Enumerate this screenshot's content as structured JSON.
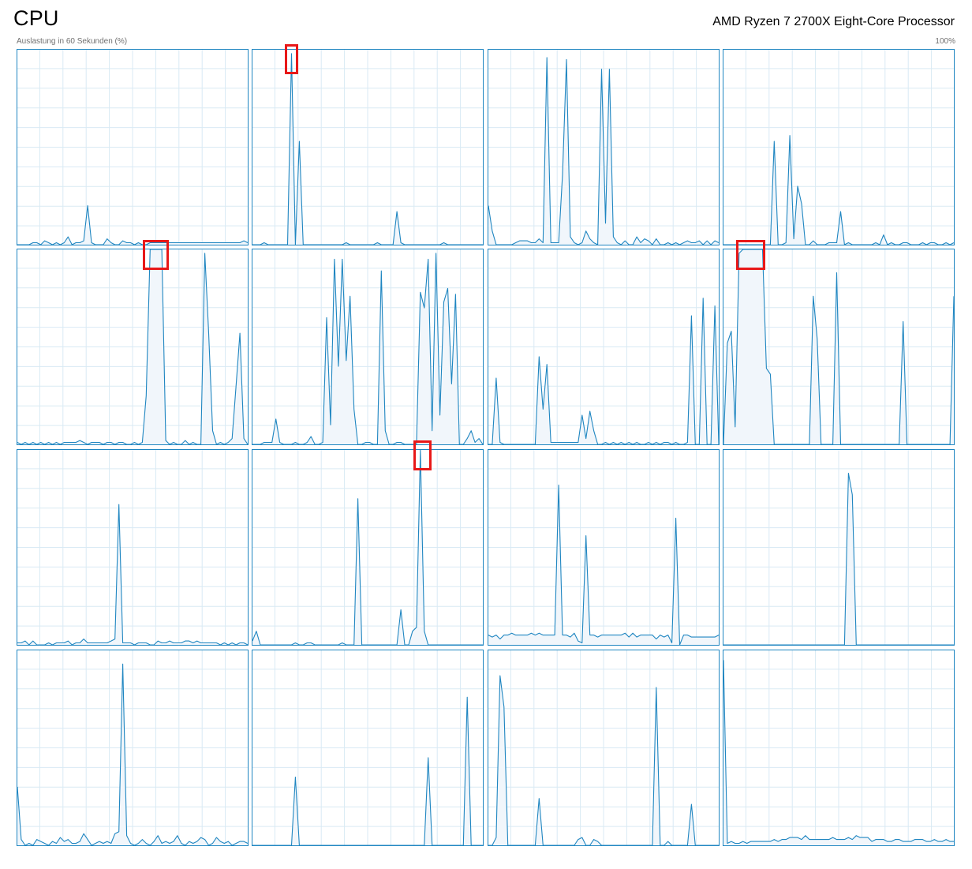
{
  "header": {
    "title": "CPU",
    "processor": "AMD Ryzen 7 2700X Eight-Core Processor",
    "utilization_label": "Auslastung in 60 Sekunden (%)",
    "max_label": "100%"
  },
  "colors": {
    "line": "#1f86c1",
    "fill": "#f1f6fb",
    "grid": "#d9eaf4",
    "border": "#1f86c1",
    "highlight": "#e81818"
  },
  "chart_data": {
    "type": "area",
    "ylim": [
      0,
      100
    ],
    "samples": 60,
    "grid": true,
    "series": [
      {
        "values": [
          0,
          0,
          0,
          0,
          1,
          1,
          0,
          2,
          1,
          0,
          1,
          0,
          1,
          4,
          0,
          1,
          1,
          2,
          20,
          1,
          0,
          0,
          0,
          3,
          1,
          0,
          0,
          2,
          1,
          1,
          0,
          1,
          0,
          0,
          1,
          1,
          1,
          1,
          1,
          1,
          1,
          1,
          1,
          1,
          1,
          1,
          1,
          1,
          1,
          1,
          1,
          1,
          1,
          1,
          1,
          1,
          1,
          1,
          2,
          1
        ]
      },
      {
        "values": [
          0,
          0,
          0,
          1,
          0,
          0,
          0,
          0,
          0,
          0,
          98,
          0,
          53,
          0,
          0,
          0,
          0,
          0,
          0,
          0,
          0,
          0,
          0,
          0,
          1,
          0,
          0,
          0,
          0,
          0,
          0,
          0,
          1,
          0,
          0,
          0,
          0,
          17,
          1,
          0,
          0,
          0,
          0,
          0,
          0,
          0,
          0,
          0,
          0,
          1,
          0,
          0,
          0,
          0,
          0,
          0,
          0,
          0,
          0,
          0
        ]
      },
      {
        "values": [
          20,
          7,
          0,
          0,
          0,
          0,
          0,
          1,
          2,
          2,
          2,
          1,
          1,
          3,
          1,
          96,
          1,
          1,
          1,
          36,
          95,
          4,
          1,
          0,
          1,
          7,
          3,
          1,
          0,
          90,
          11,
          90,
          4,
          1,
          0,
          2,
          0,
          0,
          4,
          1,
          3,
          2,
          0,
          3,
          0,
          0,
          1,
          0,
          1,
          0,
          1,
          2,
          1,
          1,
          2,
          0,
          2,
          0,
          2,
          1
        ]
      },
      {
        "values": [
          0,
          0,
          0,
          0,
          0,
          0,
          0,
          0,
          0,
          0,
          0,
          0,
          0,
          53,
          0,
          0,
          1,
          56,
          3,
          30,
          21,
          0,
          0,
          2,
          0,
          0,
          0,
          1,
          1,
          1,
          17,
          0,
          1,
          0,
          0,
          0,
          0,
          0,
          0,
          1,
          0,
          5,
          0,
          1,
          0,
          0,
          1,
          1,
          0,
          0,
          0,
          1,
          0,
          1,
          1,
          0,
          0,
          1,
          0,
          1
        ]
      },
      {
        "values": [
          1,
          0,
          1,
          0,
          1,
          0,
          1,
          0,
          1,
          0,
          1,
          0,
          1,
          1,
          1,
          1,
          2,
          1,
          0,
          1,
          1,
          1,
          0,
          1,
          1,
          0,
          1,
          1,
          0,
          0,
          1,
          0,
          1,
          25,
          100,
          100,
          100,
          100,
          2,
          0,
          1,
          0,
          0,
          2,
          0,
          1,
          0,
          0,
          98,
          57,
          7,
          0,
          1,
          0,
          1,
          3,
          30,
          57,
          3,
          0
        ]
      },
      {
        "values": [
          0,
          0,
          0,
          1,
          1,
          1,
          13,
          1,
          0,
          0,
          0,
          1,
          0,
          0,
          1,
          4,
          0,
          0,
          1,
          65,
          10,
          95,
          40,
          95,
          43,
          76,
          18,
          0,
          0,
          1,
          1,
          0,
          0,
          89,
          7,
          0,
          0,
          1,
          1,
          0,
          0,
          0,
          0,
          78,
          70,
          95,
          7,
          98,
          15,
          73,
          80,
          31,
          77,
          0,
          0,
          3,
          7,
          1,
          3,
          0
        ]
      },
      {
        "values": [
          0,
          0,
          34,
          1,
          0,
          0,
          0,
          0,
          0,
          0,
          0,
          0,
          0,
          45,
          18,
          41,
          1,
          1,
          1,
          1,
          1,
          1,
          1,
          1,
          15,
          3,
          17,
          7,
          0,
          0,
          1,
          0,
          1,
          0,
          1,
          0,
          1,
          0,
          1,
          0,
          0,
          1,
          0,
          1,
          0,
          1,
          1,
          0,
          1,
          0,
          0,
          1,
          66,
          0,
          0,
          75,
          0,
          0,
          71,
          0
        ]
      },
      {
        "values": [
          0,
          52,
          58,
          9,
          98,
          100,
          100,
          100,
          100,
          100,
          100,
          39,
          36,
          0,
          0,
          0,
          0,
          0,
          0,
          0,
          0,
          0,
          0,
          76,
          54,
          0,
          0,
          0,
          0,
          88,
          0,
          0,
          0,
          0,
          0,
          0,
          0,
          0,
          0,
          0,
          0,
          0,
          0,
          0,
          0,
          0,
          63,
          0,
          0,
          0,
          0,
          0,
          0,
          0,
          0,
          0,
          0,
          0,
          0,
          76
        ]
      },
      {
        "values": [
          1,
          1,
          2,
          0,
          2,
          0,
          0,
          0,
          1,
          0,
          1,
          1,
          1,
          2,
          0,
          1,
          1,
          3,
          1,
          1,
          1,
          1,
          1,
          1,
          2,
          3,
          72,
          1,
          1,
          1,
          0,
          1,
          1,
          1,
          0,
          0,
          2,
          1,
          1,
          2,
          1,
          1,
          1,
          2,
          2,
          1,
          2,
          1,
          1,
          1,
          1,
          1,
          0,
          1,
          0,
          1,
          0,
          1,
          1,
          0
        ]
      },
      {
        "values": [
          2,
          7,
          0,
          0,
          0,
          0,
          0,
          0,
          0,
          0,
          0,
          1,
          0,
          0,
          1,
          1,
          0,
          0,
          0,
          0,
          0,
          0,
          0,
          1,
          0,
          0,
          0,
          75,
          0,
          0,
          0,
          0,
          0,
          0,
          0,
          0,
          0,
          0,
          18,
          0,
          0,
          7,
          9,
          100,
          7,
          0,
          0,
          0,
          0,
          0,
          0,
          0,
          0,
          0,
          0,
          0,
          0,
          0,
          0,
          0
        ]
      },
      {
        "values": [
          5,
          4,
          5,
          3,
          5,
          5,
          6,
          5,
          5,
          5,
          5,
          6,
          5,
          6,
          5,
          5,
          5,
          5,
          82,
          5,
          5,
          4,
          6,
          2,
          1,
          56,
          5,
          5,
          4,
          5,
          5,
          5,
          5,
          5,
          5,
          6,
          4,
          6,
          4,
          5,
          5,
          5,
          5,
          3,
          5,
          4,
          5,
          1,
          65,
          0,
          5,
          5,
          4,
          4,
          4,
          4,
          4,
          4,
          4,
          5
        ]
      },
      {
        "values": [
          0,
          0,
          0,
          0,
          0,
          0,
          0,
          0,
          0,
          0,
          0,
          0,
          0,
          0,
          0,
          0,
          0,
          0,
          0,
          0,
          0,
          0,
          0,
          0,
          0,
          0,
          0,
          0,
          0,
          0,
          0,
          0,
          88,
          77,
          0,
          0,
          0,
          0,
          0,
          0,
          0,
          0,
          0,
          0,
          0,
          0,
          0,
          0,
          0,
          0,
          0,
          0,
          0,
          0,
          0,
          0,
          0,
          0,
          0,
          0
        ]
      },
      {
        "values": [
          30,
          3,
          0,
          1,
          0,
          3,
          2,
          1,
          0,
          2,
          1,
          4,
          2,
          3,
          1,
          1,
          2,
          6,
          3,
          0,
          1,
          2,
          1,
          2,
          1,
          6,
          7,
          93,
          5,
          1,
          0,
          1,
          3,
          1,
          0,
          2,
          5,
          1,
          2,
          1,
          2,
          5,
          1,
          0,
          2,
          1,
          2,
          4,
          3,
          0,
          1,
          4,
          2,
          1,
          2,
          0,
          1,
          2,
          2,
          1
        ]
      },
      {
        "values": [
          0,
          0,
          0,
          0,
          0,
          0,
          0,
          0,
          0,
          0,
          0,
          35,
          0,
          0,
          0,
          0,
          0,
          0,
          0,
          0,
          0,
          0,
          0,
          0,
          0,
          0,
          0,
          0,
          0,
          0,
          0,
          0,
          0,
          0,
          0,
          0,
          0,
          0,
          0,
          0,
          0,
          0,
          0,
          0,
          0,
          45,
          0,
          0,
          0,
          0,
          0,
          0,
          0,
          0,
          0,
          76,
          0,
          0,
          0,
          0
        ]
      },
      {
        "values": [
          0,
          0,
          4,
          87,
          71,
          0,
          0,
          0,
          0,
          0,
          0,
          0,
          0,
          24,
          0,
          0,
          0,
          0,
          0,
          0,
          0,
          0,
          0,
          3,
          4,
          0,
          0,
          3,
          2,
          0,
          0,
          0,
          0,
          0,
          0,
          0,
          0,
          0,
          0,
          0,
          0,
          0,
          0,
          81,
          0,
          0,
          2,
          0,
          0,
          0,
          0,
          0,
          21,
          0,
          0,
          0,
          0,
          0,
          0,
          0
        ]
      },
      {
        "values": [
          95,
          1,
          2,
          1,
          1,
          2,
          1,
          2,
          2,
          2,
          2,
          2,
          2,
          3,
          2,
          3,
          3,
          4,
          4,
          4,
          3,
          5,
          3,
          3,
          3,
          3,
          3,
          3,
          4,
          3,
          3,
          3,
          4,
          3,
          5,
          4,
          4,
          4,
          2,
          3,
          3,
          3,
          2,
          2,
          3,
          3,
          2,
          2,
          2,
          3,
          3,
          3,
          2,
          2,
          3,
          2,
          2,
          3,
          2,
          2
        ]
      }
    ]
  },
  "highlights": [
    {
      "cell": 1,
      "from": 9,
      "to": 11
    },
    {
      "cell": 4,
      "from": 33,
      "to": 38
    },
    {
      "cell": 7,
      "from": 4,
      "to": 10
    },
    {
      "cell": 9,
      "from": 42,
      "to": 45
    }
  ]
}
